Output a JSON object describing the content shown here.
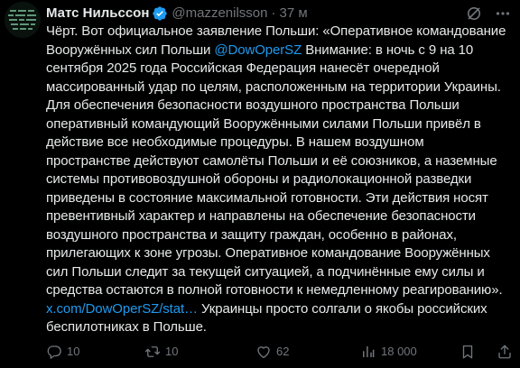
{
  "colors": {
    "background": "#000000",
    "text": "#e7e9ea",
    "secondary": "#71767b",
    "link": "#1d9bf0",
    "verified": "#1d9bf0"
  },
  "post": {
    "author_name": "Матс Нильссон",
    "verified": true,
    "handle": "@mazzenilsson",
    "separator": "·",
    "time": "37 м",
    "header_icons": [
      "grok-icon",
      "more-icon"
    ],
    "text": {
      "p1": "Чёрт. Вот официальное заявление Польши: «Оперативное командование Вооружённых сил Польши",
      "mention": "@DowOperSZ",
      "p2": "Внимание: в ночь с 9 на 10 сентября 2025 года Российская Федерация нанесёт очередной массированный удар по целям, расположенным на территории Украины. Для обеспечения безопасности воздушного пространства Польши оперативный командующий Вооружёнными силами Польши привёл в действие все необходимые процедуры. В нашем воздушном пространстве действуют самолёты Польши и её союзников, а наземные системы противовоздушной обороны и радиолокационной разведки приведены в состояние максимальной готовности. Эти действия носят превентивный характер и направлены на обеспечение безопасности воздушного пространства и защиту граждан, особенно в районах, прилегающих к зоне угрозы. Оперативное командование Вооружённых сил Польши следит за текущей ситуацией, а подчинённые ему силы и средства остаются в полной готовности к немедленному реагированию».",
      "link": "x.com/DowOperSZ/stat…",
      "p3": "Украинцы просто солгали о якобы российских беспилотниках в Польше."
    },
    "stats": {
      "replies": "10",
      "reposts": "10",
      "likes": "62",
      "views": "18 000"
    },
    "action_icons": [
      "reply-icon",
      "repost-icon",
      "like-icon",
      "views-icon",
      "bookmark-icon",
      "share-icon"
    ]
  }
}
